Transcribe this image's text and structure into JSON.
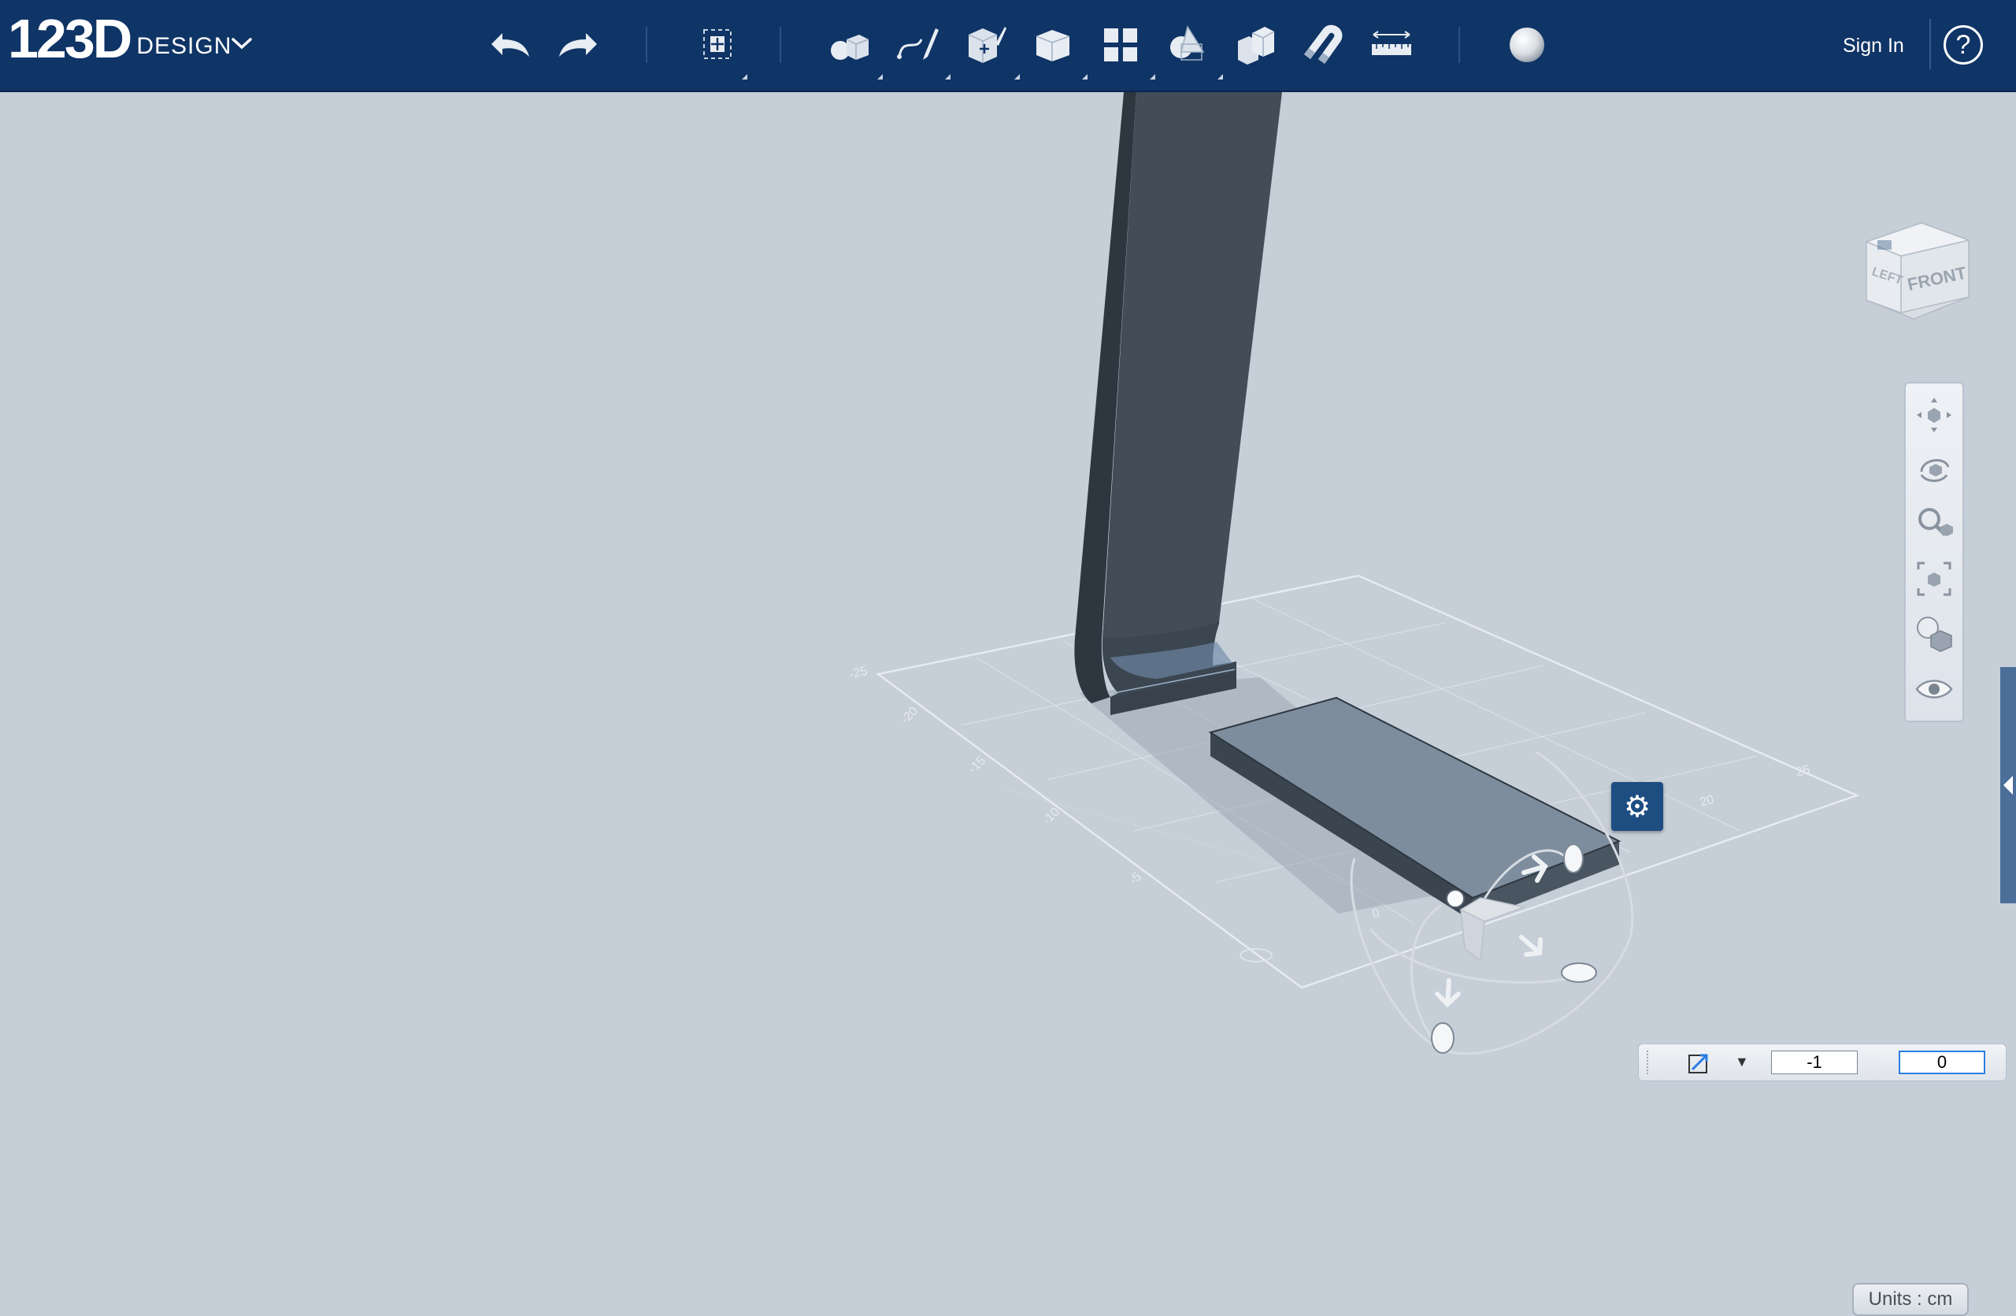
{
  "app": {
    "logo_number": "123D",
    "logo_word": "DESIGN"
  },
  "toolbar": {
    "buttons": [
      {
        "name": "undo-icon"
      },
      {
        "name": "redo-icon"
      },
      {
        "name": "transform-icon"
      },
      {
        "name": "primitives-icon"
      },
      {
        "name": "sketch-icon"
      },
      {
        "name": "construct-icon"
      },
      {
        "name": "modify-icon"
      },
      {
        "name": "pattern-icon"
      },
      {
        "name": "combine-icon"
      },
      {
        "name": "group-icon"
      },
      {
        "name": "snap-icon"
      },
      {
        "name": "measure-icon"
      },
      {
        "name": "material-icon"
      }
    ],
    "sign_in_label": "Sign In",
    "help_label": "?"
  },
  "viewcube": {
    "front_label": "FRONT",
    "left_label": "LEFT"
  },
  "navbar": {
    "items": [
      "pan-icon",
      "orbit-icon",
      "zoom-icon",
      "fit-icon",
      "visual-style-icon",
      "visibility-icon"
    ]
  },
  "move_panel": {
    "first_value": "-1",
    "second_value": "0"
  },
  "units_label": "Units : cm",
  "colors": {
    "toolbar_bg": "#0f3466",
    "viewport_bg": "#c6ced8",
    "accent": "#1e4d82"
  }
}
